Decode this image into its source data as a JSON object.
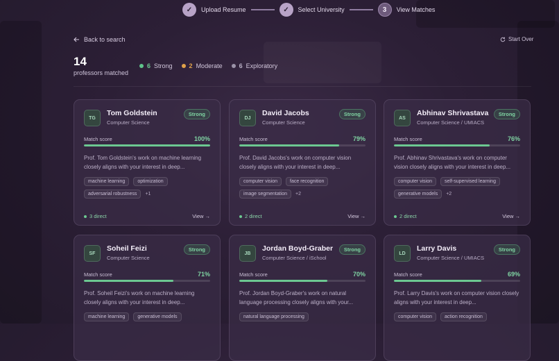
{
  "stepper": {
    "steps": [
      {
        "badge": "✓",
        "label": "Upload Resume"
      },
      {
        "badge": "✓",
        "label": "Select University"
      },
      {
        "badge": "3",
        "label": "View Matches"
      }
    ]
  },
  "nav": {
    "back_label": "Back to search",
    "start_over_label": "Start Over"
  },
  "summary": {
    "count": "14",
    "count_label": "professors matched",
    "legend": [
      {
        "count": "6",
        "label": "Strong",
        "color": "#5fc48b"
      },
      {
        "count": "2",
        "label": "Moderate",
        "color": "#e0a24a"
      },
      {
        "count": "6",
        "label": "Exploratory",
        "color": "#9b93a8"
      }
    ]
  },
  "cards": [
    {
      "initials": "TG",
      "name": "Tom Goldstein",
      "dept": "Computer Science",
      "badge": "Strong",
      "score_label": "Match score",
      "score": "100%",
      "score_value": 100,
      "desc": "Prof. Tom Goldstein's work on machine learning closely aligns with your interest in deep...",
      "tags": [
        "machine learning",
        "optimization",
        "adversarial robustness"
      ],
      "more": "+1",
      "direct": "3 direct",
      "view": "View →"
    },
    {
      "initials": "DJ",
      "name": "David Jacobs",
      "dept": "Computer Science",
      "badge": "Strong",
      "score_label": "Match score",
      "score": "79%",
      "score_value": 79,
      "desc": "Prof. David Jacobs's work on computer vision closely aligns with your interest in deep...",
      "tags": [
        "computer vision",
        "face recognition",
        "image segmentation"
      ],
      "more": "+2",
      "direct": "2 direct",
      "view": "View →"
    },
    {
      "initials": "AS",
      "name": "Abhinav Shrivastava",
      "dept": "Computer Science / UMIACS",
      "badge": "Strong",
      "score_label": "Match score",
      "score": "76%",
      "score_value": 76,
      "desc": "Prof. Abhinav Shrivastava's work on computer vision closely aligns with your interest in deep...",
      "tags": [
        "computer vision",
        "self-supervised learning",
        "generative models"
      ],
      "more": "+2",
      "direct": "2 direct",
      "view": "View →"
    },
    {
      "initials": "SF",
      "name": "Soheil Feizi",
      "dept": "Computer Science",
      "badge": "Strong",
      "score_label": "Match score",
      "score": "71%",
      "score_value": 71,
      "desc": "Prof. Soheil Feizi's work on machine learning closely aligns with your interest in deep...",
      "tags": [
        "machine learning",
        "generative models"
      ],
      "more": "",
      "direct": "",
      "view": ""
    },
    {
      "initials": "JB",
      "name": "Jordan Boyd-Graber",
      "dept": "Computer Science / iSchool",
      "badge": "Strong",
      "score_label": "Match score",
      "score": "70%",
      "score_value": 70,
      "desc": "Prof. Jordan Boyd-Graber's work on natural language processing closely aligns with your...",
      "tags": [
        "natural language processing"
      ],
      "more": "",
      "direct": "",
      "view": ""
    },
    {
      "initials": "LD",
      "name": "Larry Davis",
      "dept": "Computer Science / UMIACS",
      "badge": "Strong",
      "score_label": "Match score",
      "score": "69%",
      "score_value": 69,
      "desc": "Prof. Larry Davis's work on computer vision closely aligns with your interest in deep...",
      "tags": [
        "computer vision",
        "action recognition"
      ],
      "more": "",
      "direct": "",
      "view": ""
    }
  ]
}
